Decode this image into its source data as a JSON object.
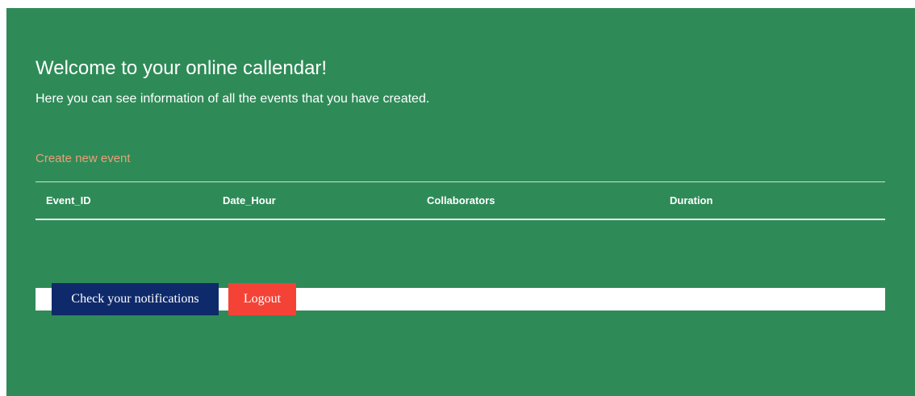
{
  "header": {
    "title": "Welcome to your online callendar!",
    "subtitle": "Here you can see information of all the events that you have created."
  },
  "actions": {
    "create_event_link": "Create new event"
  },
  "events_table": {
    "columns": [
      "Event_ID",
      "Date_Hour",
      "Collaborators",
      "Duration"
    ],
    "rows": []
  },
  "footer": {
    "notifications_button": "Check your notifications",
    "logout_button": "Logout"
  },
  "colors": {
    "background": "#2e8b57",
    "link": "#e9a07a",
    "notifications_button": "#0f2a6b",
    "logout_button": "#f44336"
  }
}
